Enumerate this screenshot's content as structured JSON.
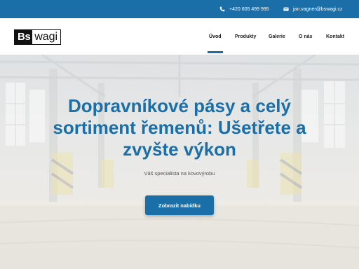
{
  "topbar": {
    "phone": "+420 605 499 995",
    "phone_icon": "phone-icon",
    "email": "jan.vagner@bswagi.cz",
    "email_icon": "envelope-icon"
  },
  "logo": {
    "part1": "Bs",
    "part2": "wagi"
  },
  "nav": {
    "items": [
      {
        "label": "Úvod",
        "active": true
      },
      {
        "label": "Produkty",
        "active": false
      },
      {
        "label": "Galerie",
        "active": false
      },
      {
        "label": "O nás",
        "active": false
      },
      {
        "label": "Kontakt",
        "active": false
      }
    ]
  },
  "hero": {
    "headline_line1": "Dopravníkové pásy a celý",
    "headline_line2": "sortiment řemenů: Ušetřete a",
    "headline_line3": "zvyšte výkon",
    "subline": "Váš specialista na kovovýrobu",
    "cta_label": "Zobrazit nabídku"
  },
  "colors": {
    "accent": "#1a6fa8",
    "topbar": "#1a6fa8"
  }
}
